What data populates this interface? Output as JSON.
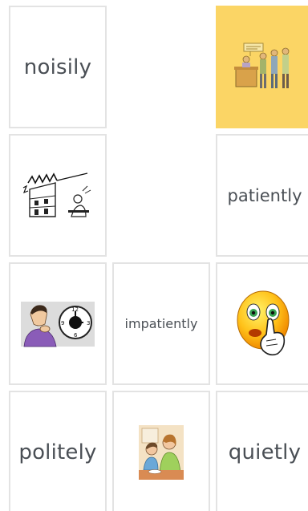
{
  "colors": {
    "card_border": "#e3e3e3",
    "selected_bg": "#fbd565",
    "text": "#4a4f55"
  },
  "cards": [
    {
      "row": 1,
      "col": 1,
      "kind": "word",
      "text": "noisily"
    },
    {
      "row": 1,
      "col": 3,
      "kind": "picture",
      "icon": "people-waiting-at-counter-icon",
      "selected": true
    },
    {
      "row": 2,
      "col": 1,
      "kind": "picture",
      "icon": "noisy-neighbour-icon"
    },
    {
      "row": 2,
      "col": 3,
      "kind": "word",
      "text": "patiently"
    },
    {
      "row": 3,
      "col": 1,
      "kind": "picture",
      "icon": "man-waiting-clock-icon"
    },
    {
      "row": 3,
      "col": 2,
      "kind": "word",
      "text": "impatiently"
    },
    {
      "row": 3,
      "col": 3,
      "kind": "picture",
      "icon": "shushing-smiley-icon"
    },
    {
      "row": 4,
      "col": 1,
      "kind": "word",
      "text": "politely"
    },
    {
      "row": 4,
      "col": 2,
      "kind": "picture",
      "icon": "mother-and-child-talking-icon"
    },
    {
      "row": 4,
      "col": 3,
      "kind": "word",
      "text": "quietly"
    }
  ]
}
